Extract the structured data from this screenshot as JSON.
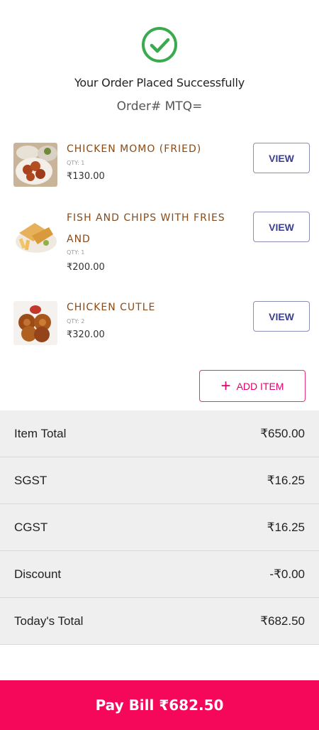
{
  "header": {
    "title": "Your Order Placed Successfully",
    "order_number": "Order# MTQ=",
    "status_color": "#3aaa4e"
  },
  "items": [
    {
      "name": "CHICKEN MOMO (FRIED)",
      "qty": "QTY: 1",
      "price": "₹130.00",
      "view_label": "VIEW"
    },
    {
      "name": "FISH AND CHIPS WITH FRIES AND",
      "qty": "QTY: 1",
      "price": "₹200.00",
      "view_label": "VIEW"
    },
    {
      "name": "CHICKEN CUTLE",
      "qty": "QTY: 2",
      "price": "₹320.00",
      "view_label": "VIEW"
    }
  ],
  "add_item": {
    "label": "ADD ITEM",
    "color": "#e6006a"
  },
  "bill": {
    "rows": [
      {
        "label": "Item Total",
        "value": "₹650.00"
      },
      {
        "label": "SGST",
        "value": "₹16.25"
      },
      {
        "label": "CGST",
        "value": "₹16.25"
      },
      {
        "label": "Discount",
        "value": "-₹0.00"
      },
      {
        "label": "Today's Total",
        "value": "₹682.50"
      }
    ]
  },
  "pay": {
    "label": "Pay Bill ₹682.50",
    "color": "#f5075a"
  }
}
